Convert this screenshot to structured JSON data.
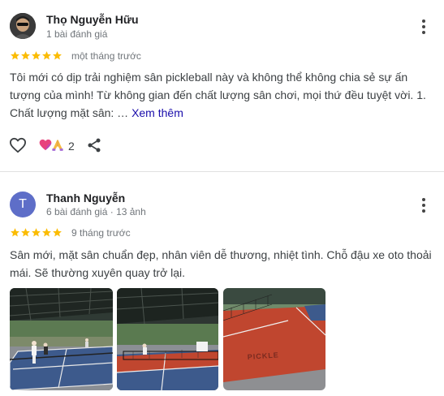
{
  "reviews": [
    {
      "author": "Thọ Nguyễn Hữu",
      "meta": "1 bài đánh giá",
      "rating": 5,
      "time_ago": "một tháng trước",
      "text": "Tôi mới có dịp trải nghiệm sân pickleball này và không thể không chia sẻ sự ấn tượng của mình! Từ không gian đến chất lượng sân chơi, mọi thứ đều tuyệt vời. 1. Chất lượng mặt sân: …",
      "see_more": "Xem thêm",
      "reaction_count": "2"
    },
    {
      "author": "Thanh Nguyễn",
      "avatar_letter": "T",
      "meta": "6 bài đánh giá · 13 ảnh",
      "rating": 5,
      "time_ago": "9 tháng trước",
      "text": "Sân mới, mặt sân chuẩn đẹp, nhân viên dễ thương, nhiệt tình. Chỗ đậu xe oto thoải mái. Sẽ thường xuyên quay trở lại.",
      "photo_court_text": "PICKLE"
    }
  ],
  "colors": {
    "star": "#fbbc04",
    "link": "#1a0dab",
    "avatar_bg": "#5e6ec8",
    "court_blue": "#3d5a8c",
    "court_red": "#c0462f"
  },
  "icons": [
    "more-vert-icon",
    "star-icon",
    "heart-outline-icon",
    "heart-reaction-icon",
    "pray-reaction-icon",
    "share-icon"
  ]
}
